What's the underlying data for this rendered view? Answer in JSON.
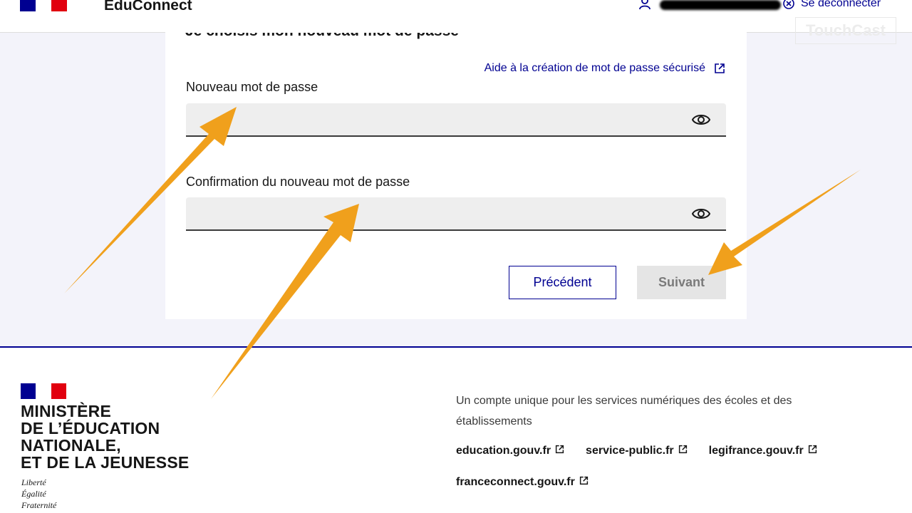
{
  "header": {
    "brand": "EduConnect",
    "logout_label": "Se déconnecter",
    "watermark": "TouchCast"
  },
  "form": {
    "title": "Je choisis mon nouveau mot de passe",
    "help_link": "Aide à la création de mot de passe sécurisé",
    "new_password_label": "Nouveau mot de passe",
    "new_password_value": "",
    "confirm_password_label": "Confirmation du nouveau mot de passe",
    "confirm_password_value": "",
    "previous_button": "Précédent",
    "next_button": "Suivant"
  },
  "footer": {
    "ministry_lines": [
      "MINISTÈRE",
      "DE L’ÉDUCATION",
      "NATIONALE,",
      "ET DE LA JEUNESSE"
    ],
    "motto": [
      "Liberté",
      "Égalité",
      "Fraternité"
    ],
    "description": "Un compte unique pour les services numériques des écoles et des établissements",
    "links": [
      "education.gouv.fr",
      "service-public.fr",
      "legifrance.gouv.fr",
      "franceconnect.gouv.fr"
    ]
  },
  "colors": {
    "primary_blue": "#000091",
    "flag_red": "#e1000f",
    "arrow_orange": "#f0a01c",
    "page_background": "#f3f3fa"
  }
}
